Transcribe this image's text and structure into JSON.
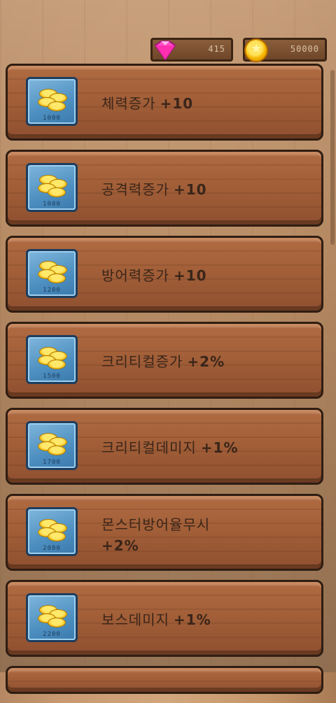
{
  "currencies": {
    "gems": "415",
    "gold": "50000"
  },
  "close_label": "✕",
  "items": [
    {
      "label": "체력증가",
      "bonus": "+10",
      "price": "1000"
    },
    {
      "label": "공격력증가",
      "bonus": "+10",
      "price": "1000"
    },
    {
      "label": "방어력증가",
      "bonus": "+10",
      "price": "1200"
    },
    {
      "label": "크리티컬증가",
      "bonus": "+2%",
      "price": "1500"
    },
    {
      "label": "크리티컬데미지",
      "bonus": "+1%",
      "price": "1700"
    },
    {
      "label": "몬스터방어율무시",
      "bonus": "+2%",
      "price": "2000"
    },
    {
      "label": "보스데미지",
      "bonus": "+1%",
      "price": "2200"
    }
  ]
}
